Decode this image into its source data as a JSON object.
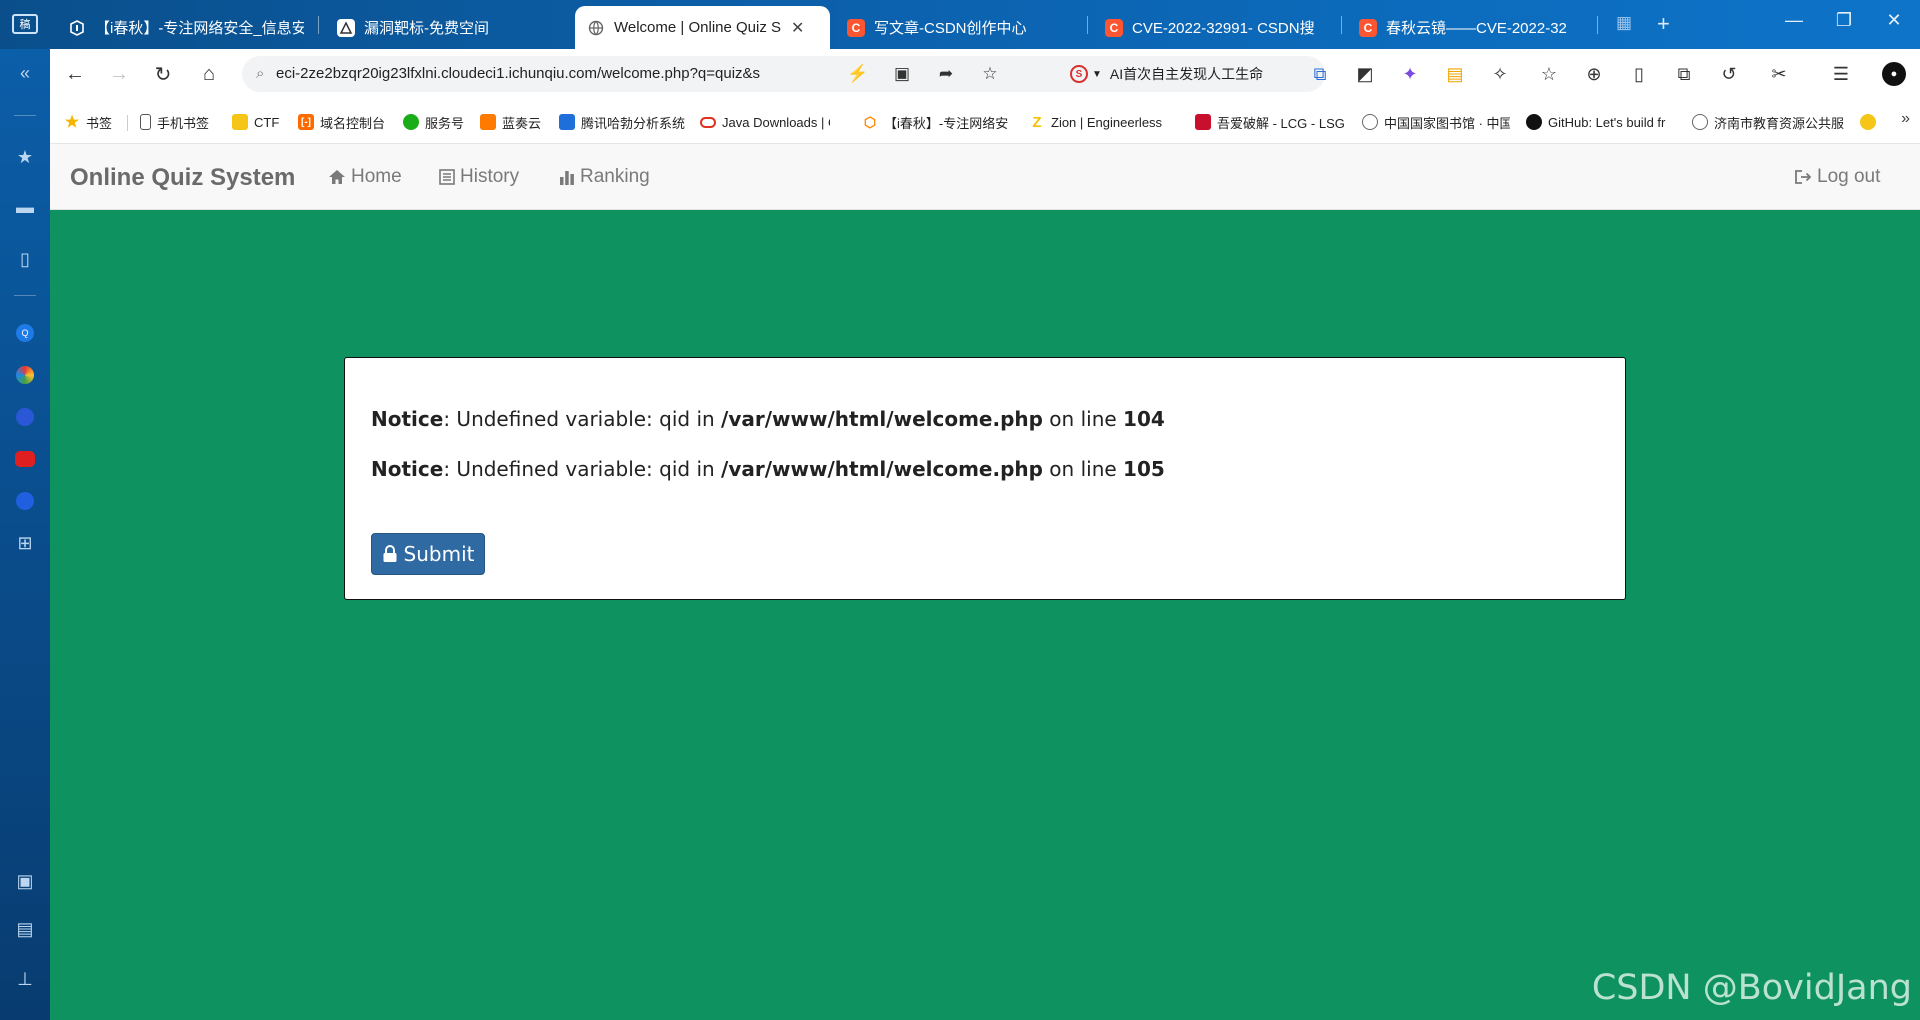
{
  "browser": {
    "window_badge": "稿",
    "tabs": [
      {
        "title": "【i春秋】-专注网络安全_信息安",
        "icon": "ichunqiu-icon",
        "active": false
      },
      {
        "title": "漏洞靶标-免费空间",
        "icon": "target-site-icon",
        "active": false
      },
      {
        "title": "Welcome | Online Quiz S",
        "icon": "globe-icon",
        "active": true
      },
      {
        "title": "写文章-CSDN创作中心",
        "icon": "csdn-icon",
        "active": false
      },
      {
        "title": "CVE-2022-32991- CSDN搜",
        "icon": "csdn-icon",
        "active": false
      },
      {
        "title": "春秋云镜——CVE-2022-32",
        "icon": "csdn-icon",
        "active": false
      }
    ],
    "address_url": "eci-2ze2bzqr20ig23lfxlni.cloudeci1.ichunqiu.com/welcome.php?q=quiz&s",
    "ai_search_text": "AI首次自主发现人工生命",
    "ai_badge": "S",
    "bookmarks": [
      {
        "label": "书签",
        "icon": "star-icon",
        "color": "#f5b400"
      },
      {
        "label": "手机书签",
        "icon": "phone-icon",
        "color": "#555555"
      },
      {
        "label": "CTF",
        "icon": "folder-icon",
        "color": "#f5c518"
      },
      {
        "label": "域名控制台",
        "icon": "aliyun-icon",
        "color": "#ff6a00"
      },
      {
        "label": "服务号",
        "icon": "wechat-icon",
        "color": "#1aad19"
      },
      {
        "label": "蓝奏云",
        "icon": "lanzou-icon",
        "color": "#ff7a00"
      },
      {
        "label": "腾讯哈勃分析系统",
        "icon": "habo-icon",
        "color": "#1e6fd9"
      },
      {
        "label": "Java Downloads | Or",
        "icon": "oracle-icon",
        "color": "#e0301e"
      },
      {
        "label": "【i春秋】-专注网络安",
        "icon": "ichunqiu-icon",
        "color": "#ff8a00"
      },
      {
        "label": "Zion | Engineerless",
        "icon": "zion-icon",
        "color": "#f2c200"
      },
      {
        "label": "吾爱破解 - LCG - LSG",
        "icon": "52pojie-icon",
        "color": "#c8102e"
      },
      {
        "label": "中国国家图书馆 · 中国",
        "icon": "globe-icon",
        "color": "#666666"
      },
      {
        "label": "GitHub: Let's build fr",
        "icon": "github-icon",
        "color": "#111111"
      },
      {
        "label": "济南市教育资源公共服",
        "icon": "globe-icon",
        "color": "#666666"
      }
    ]
  },
  "page": {
    "brand": "Online Quiz System",
    "nav": {
      "home": "Home",
      "history": "History",
      "ranking": "Ranking",
      "logout": "Log out"
    },
    "notices": [
      {
        "label": "Notice",
        "message": ": Undefined variable: qid in ",
        "path": "/var/www/html/welcome.php",
        "on_line": " on line ",
        "line": "104"
      },
      {
        "label": "Notice",
        "message": ": Undefined variable: qid in ",
        "path": "/var/www/html/welcome.php",
        "on_line": " on line ",
        "line": "105"
      }
    ],
    "submit_label": "Submit",
    "background_color": "#0e9360",
    "button_color": "#2f6aa3"
  },
  "watermark": "CSDN @BovidJang"
}
